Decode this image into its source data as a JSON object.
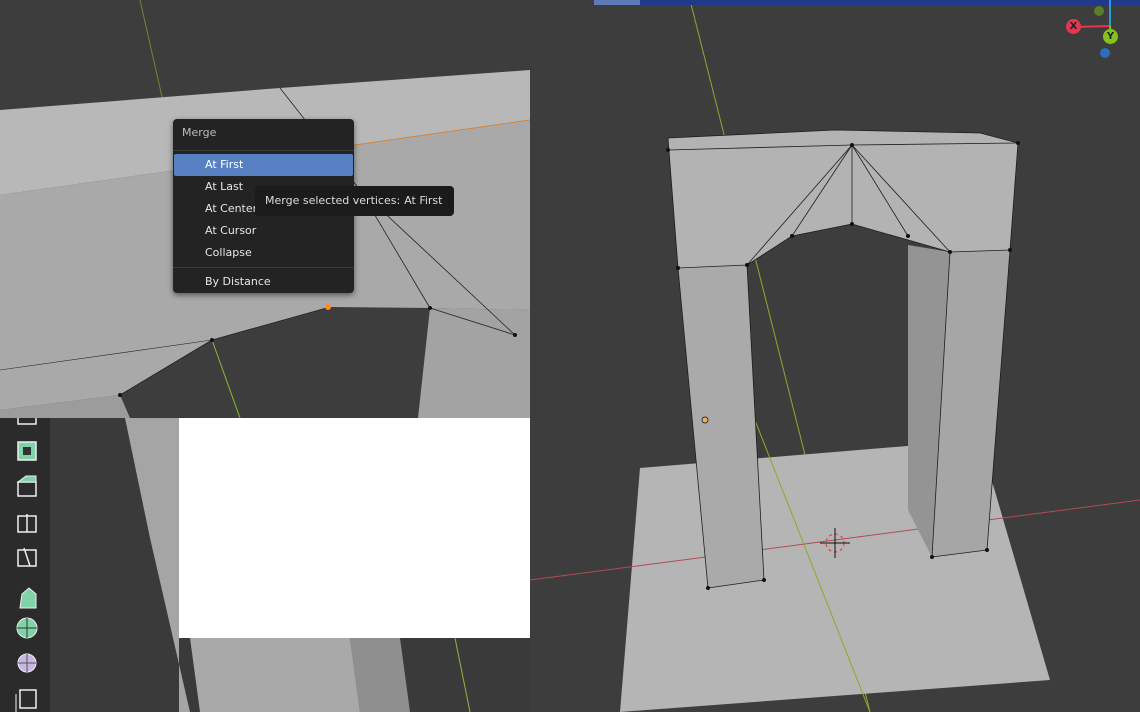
{
  "merge_menu": {
    "title": "Merge",
    "items": [
      {
        "label": "At First",
        "active": true
      },
      {
        "label": "At Last",
        "active": false
      },
      {
        "label": "At Center",
        "active": false
      },
      {
        "label": "At Cursor",
        "active": false
      },
      {
        "label": "Collapse",
        "active": false
      },
      {
        "label": "By Distance",
        "active": false
      }
    ]
  },
  "tooltip": {
    "text": "Merge selected vertices:",
    "value": "At First"
  },
  "gizmo": {
    "x_label": "X",
    "y_label": "Y",
    "x_color": "#e8344e",
    "y_color": "#86c21d",
    "z_color": "#2c6fbf"
  },
  "toolbar": {
    "tools": [
      "transform-tool",
      "inset-faces-tool",
      "bevel-tool",
      "loop-cut-tool",
      "knife-tool",
      "poly-build-tool",
      "spin-tool",
      "smooth-tool",
      "shear-tool"
    ]
  },
  "colors": {
    "viewport_bg": "#3d3d3d",
    "mesh_face": "#a8a8a8",
    "menu_highlight": "#5680c2"
  }
}
